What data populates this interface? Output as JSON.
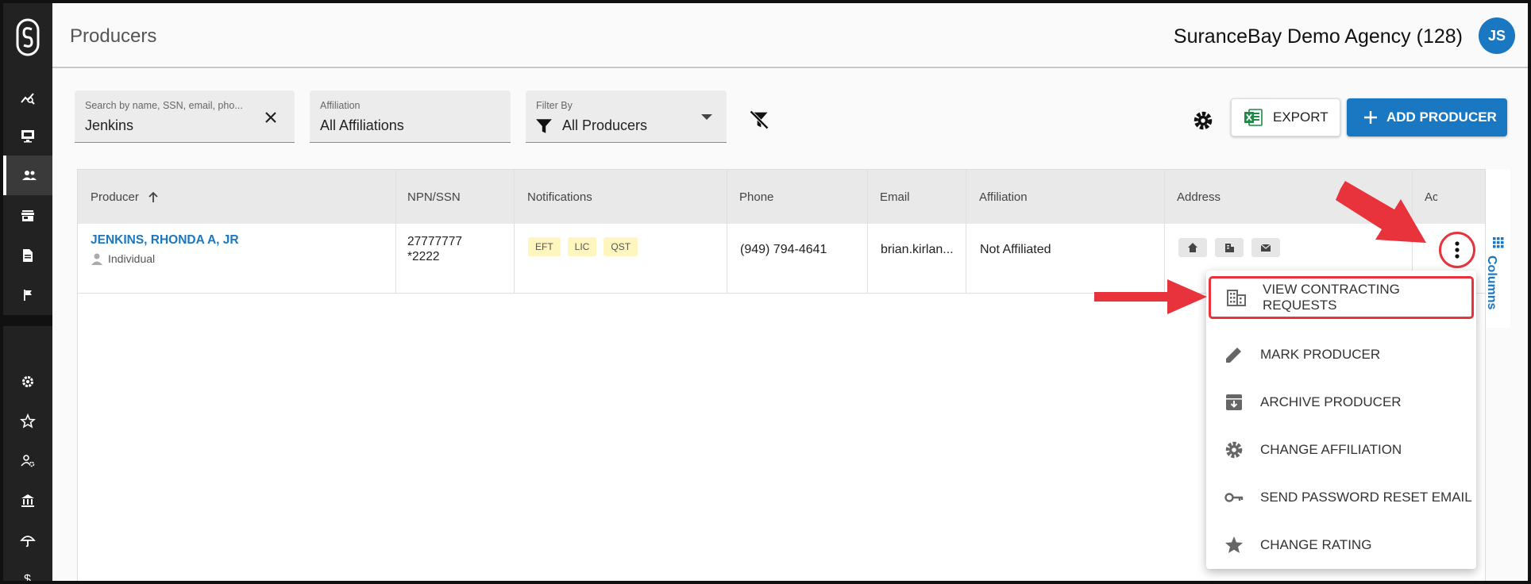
{
  "app": {
    "page_title": "Producers",
    "agency": "SuranceBay Demo Agency (128)",
    "user_initials": "JS"
  },
  "colors": {
    "accent": "#1a78c2",
    "sidebar": "#222222",
    "highlight": "#e8323c",
    "badge_bg": "#fff5bf"
  },
  "sidebar": {
    "items": [
      "dashboard-icon",
      "computer-icon",
      "people-icon",
      "store-icon",
      "document-icon",
      "flag-icon",
      "gear-icon",
      "star-badge-icon",
      "user-settings-icon",
      "bank-icon",
      "umbrella-icon",
      "dollar-icon"
    ],
    "active": "people-icon"
  },
  "filters": {
    "search": {
      "label": "Search by name, SSN, email, pho...",
      "value": "Jenkins"
    },
    "affiliation": {
      "label": "Affiliation",
      "value": "All Affiliations"
    },
    "filter_by": {
      "label": "Filter By",
      "value": "All Producers"
    }
  },
  "toolbar": {
    "export_label": "EXPORT",
    "add_label": "ADD PRODUCER"
  },
  "table": {
    "columns": [
      "Producer",
      "NPN/SSN",
      "Notifications",
      "Phone",
      "Email",
      "Affiliation",
      "Address",
      "Ac"
    ],
    "rows": [
      {
        "producer": "JENKINS, RHONDA A, JR",
        "type": "Individual",
        "npn": "27777777",
        "ssn": "*2222",
        "notifications": [
          "EFT",
          "LIC",
          "QST"
        ],
        "phone": "(949) 794-4641",
        "email": "brian.kirlan...",
        "affiliation": "Not Affiliated"
      }
    ]
  },
  "columns_tab": "Columns",
  "row_menu": {
    "items": [
      {
        "label": "VIEW CONTRACTING REQUESTS",
        "icon": "building-icon"
      },
      {
        "label": "MARK PRODUCER",
        "icon": "pencil-icon"
      },
      {
        "label": "ARCHIVE PRODUCER",
        "icon": "archive-icon"
      },
      {
        "label": "CHANGE AFFILIATION",
        "icon": "gear-icon"
      },
      {
        "label": "SEND PASSWORD RESET EMAIL",
        "icon": "key-icon"
      },
      {
        "label": "CHANGE RATING",
        "icon": "star-icon"
      }
    ]
  }
}
